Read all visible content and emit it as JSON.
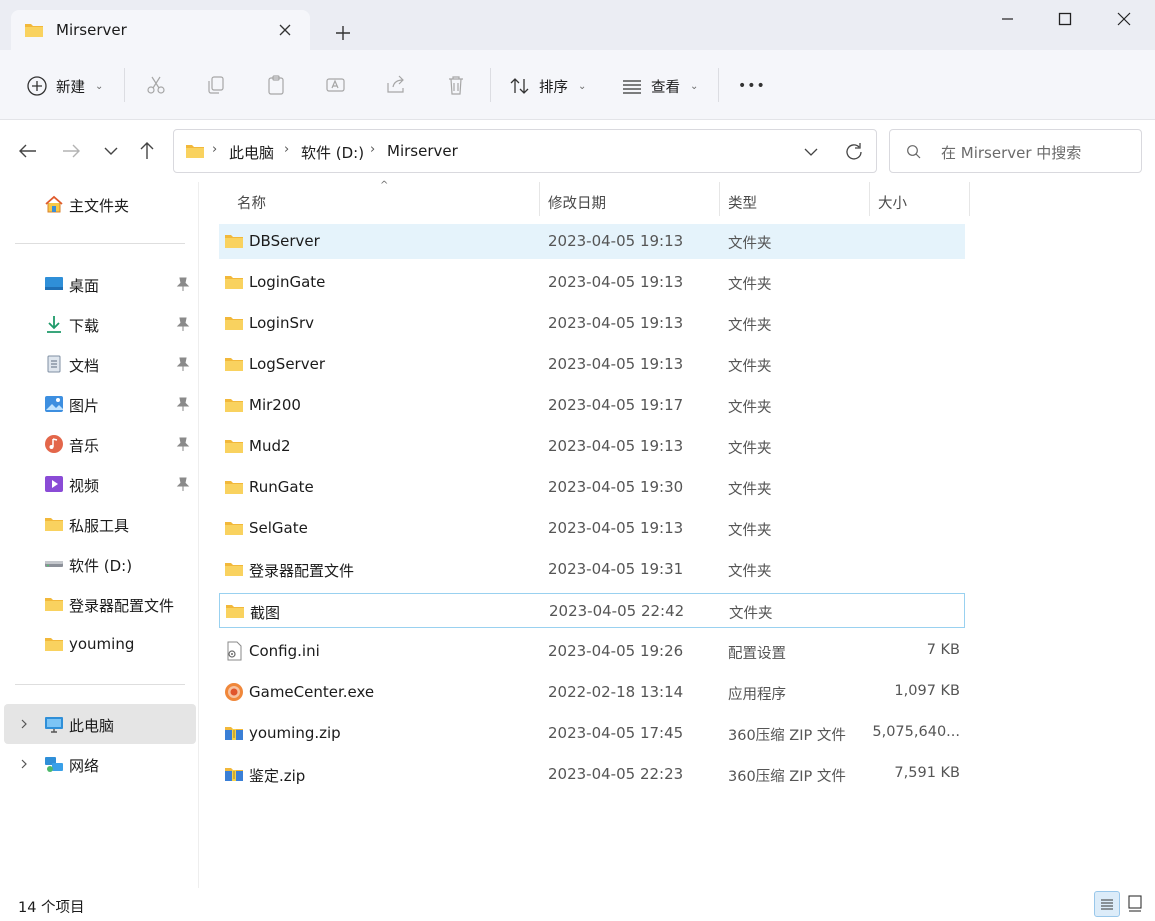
{
  "window": {
    "tab_title": "Mirserver",
    "icons": {
      "tab": "folder-icon",
      "close_tab": "close-icon",
      "new_tab": "plus-icon",
      "minimize": "minimize-icon",
      "maximize": "maximize-icon",
      "close": "close-icon"
    }
  },
  "toolbar": {
    "new_label": "新建",
    "sort_label": "排序",
    "view_label": "查看",
    "more_label": "•••",
    "icons": [
      "cut-icon",
      "copy-icon",
      "paste-icon",
      "rename-icon",
      "share-icon",
      "delete-icon"
    ]
  },
  "address": {
    "crumbs": [
      "此电脑",
      "软件 (D:)",
      "Mirserver"
    ],
    "search_placeholder": "在 Mirserver 中搜索"
  },
  "sidebar": {
    "home": "主文件夹",
    "items": [
      {
        "label": "桌面",
        "icon": "desktop-icon",
        "pinned": true
      },
      {
        "label": "下载",
        "icon": "download-icon",
        "pinned": true
      },
      {
        "label": "文档",
        "icon": "document-icon",
        "pinned": true
      },
      {
        "label": "图片",
        "icon": "pictures-icon",
        "pinned": true
      },
      {
        "label": "音乐",
        "icon": "music-icon",
        "pinned": true
      },
      {
        "label": "视频",
        "icon": "video-icon",
        "pinned": true
      },
      {
        "label": "私服工具",
        "icon": "folder-icon",
        "pinned": false
      },
      {
        "label": "软件 (D:)",
        "icon": "drive-icon",
        "pinned": false
      },
      {
        "label": "登录器配置文件",
        "icon": "folder-icon",
        "pinned": false
      },
      {
        "label": "youming",
        "icon": "folder-icon",
        "pinned": false
      }
    ],
    "bottom": [
      {
        "label": "此电脑",
        "icon": "computer-icon",
        "selected": true
      },
      {
        "label": "网络",
        "icon": "network-icon",
        "selected": false
      }
    ]
  },
  "columns": {
    "name": "名称",
    "date": "修改日期",
    "type": "类型",
    "size": "大小"
  },
  "files": [
    {
      "name": "DBServer",
      "date": "2023-04-05 19:13",
      "type": "文件夹",
      "size": "",
      "icon": "folder-icon"
    },
    {
      "name": "LoginGate",
      "date": "2023-04-05 19:13",
      "type": "文件夹",
      "size": "",
      "icon": "folder-icon"
    },
    {
      "name": "LoginSrv",
      "date": "2023-04-05 19:13",
      "type": "文件夹",
      "size": "",
      "icon": "folder-icon"
    },
    {
      "name": "LogServer",
      "date": "2023-04-05 19:13",
      "type": "文件夹",
      "size": "",
      "icon": "folder-icon"
    },
    {
      "name": "Mir200",
      "date": "2023-04-05 19:17",
      "type": "文件夹",
      "size": "",
      "icon": "folder-icon"
    },
    {
      "name": "Mud2",
      "date": "2023-04-05 19:13",
      "type": "文件夹",
      "size": "",
      "icon": "folder-icon"
    },
    {
      "name": "RunGate",
      "date": "2023-04-05 19:30",
      "type": "文件夹",
      "size": "",
      "icon": "folder-icon"
    },
    {
      "name": "SelGate",
      "date": "2023-04-05 19:13",
      "type": "文件夹",
      "size": "",
      "icon": "folder-icon"
    },
    {
      "name": "登录器配置文件",
      "date": "2023-04-05 19:31",
      "type": "文件夹",
      "size": "",
      "icon": "folder-icon"
    },
    {
      "name": "截图",
      "date": "2023-04-05 22:42",
      "type": "文件夹",
      "size": "",
      "icon": "folder-icon"
    },
    {
      "name": "Config.ini",
      "date": "2023-04-05 19:26",
      "type": "配置设置",
      "size": "7 KB",
      "icon": "ini-file-icon"
    },
    {
      "name": "GameCenter.exe",
      "date": "2022-02-18 13:14",
      "type": "应用程序",
      "size": "1,097 KB",
      "icon": "app-icon"
    },
    {
      "name": "youming.zip",
      "date": "2023-04-05 17:45",
      "type": "360压缩 ZIP 文件",
      "size": "5,075,640...",
      "icon": "zip-icon"
    },
    {
      "name": "鉴定.zip",
      "date": "2023-04-05 22:23",
      "type": "360压缩 ZIP 文件",
      "size": "7,591 KB",
      "icon": "zip-icon"
    }
  ],
  "status": {
    "count": "14 个项目"
  },
  "colors": {
    "hover_row": "#e5f3fb",
    "focus_border": "#99d1f0",
    "folder": "#f7c948",
    "selected_side": "#e5e5e5"
  }
}
